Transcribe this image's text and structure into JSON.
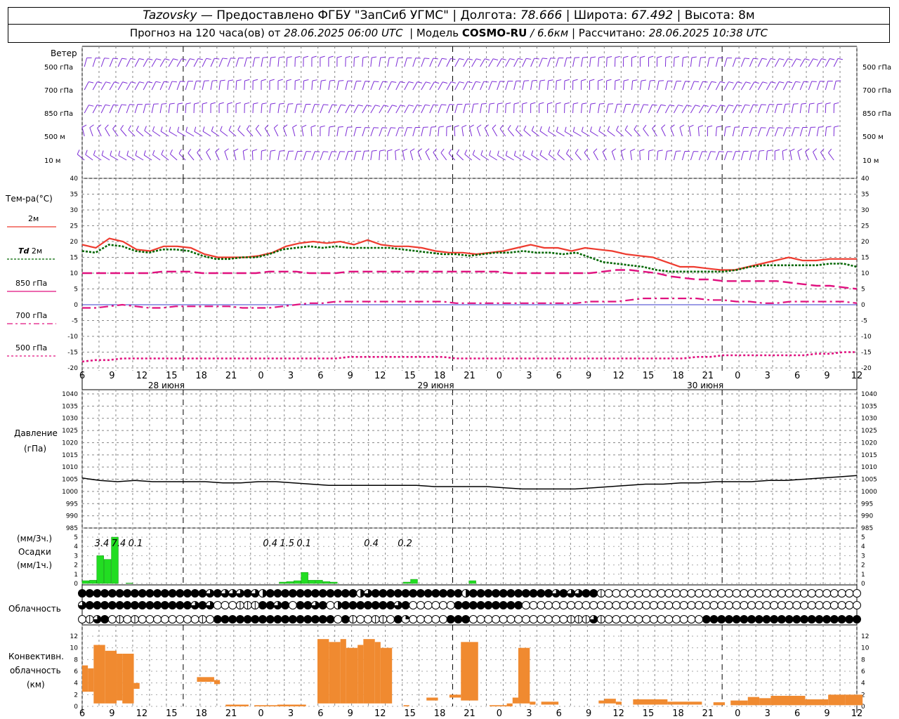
{
  "header": {
    "station": "Tazovsky",
    "provider": "Предоставлено ФГБУ \"ЗапСиб УГМС\"",
    "lon_label": "Долгота:",
    "lon": "78.666",
    "lat_label": "Широта:",
    "lat": "67.492",
    "alt_label": "Высота:",
    "alt": "8м",
    "forecast_prefix": "Прогноз на 120 часа(ов) от",
    "forecast_from": "28.06.2025 06:00 UTC",
    "model_label": "Модель",
    "model": "COSMO-RU",
    "resolution": "/ 6.6км",
    "calc_label": "Рассчитано:",
    "calc_time": "28.06.2025 10:38 UTC"
  },
  "labels": {
    "wind": "Ветер",
    "levels": [
      "500 гПа",
      "700 гПа",
      "850 гПа",
      "500 м",
      "10 м"
    ],
    "temp": "Тем-ра(°С)",
    "t2m": "2м",
    "td_prefix": "Td",
    "td_suffix": "2м",
    "t850": "850 гПа",
    "t700": "700 гПа",
    "t500": "500 гПа",
    "pressure": "Давление",
    "pressure_unit": "(гПа)",
    "precip_unit3": "(мм/3ч.)",
    "precip": "Осадки",
    "precip_unit1": "(мм/1ч.)",
    "cloud": "Облачность",
    "conv1": "Конвективн.",
    "conv2": "облачность",
    "conv3": "(км)"
  },
  "colors": {
    "t2m": "#ee3b2f",
    "td2m": "#006600",
    "t850": "#e0117f",
    "t700": "#e0117f",
    "t500": "#e0117f",
    "wind": "#7b2bd6",
    "pressure": "#000000",
    "precip": "#22dd22",
    "conv": "#f08a30"
  },
  "chart_data": {
    "type": "line",
    "x_ticks": [
      "6",
      "9",
      "12",
      "15",
      "18",
      "21",
      "0",
      "3",
      "6",
      "9",
      "12",
      "15",
      "18",
      "21",
      "0",
      "3",
      "6",
      "9",
      "12",
      "15",
      "18",
      "21",
      "0",
      "3",
      "6",
      "9",
      "12"
    ],
    "dates": [
      "28 июня",
      "29 июня",
      "30 июня"
    ],
    "temperature": {
      "ylim": [
        -20,
        40
      ],
      "ticks": [
        -20,
        -15,
        -10,
        -5,
        0,
        5,
        10,
        15,
        20,
        25,
        30,
        35,
        40
      ],
      "series": [
        {
          "name": "2м",
          "values": [
            19,
            18,
            21,
            20,
            17.5,
            17,
            18.5,
            18.5,
            18,
            16,
            15,
            15,
            15,
            15.5,
            16.5,
            18.5,
            19.5,
            20,
            19.5,
            20,
            19,
            20.5,
            19,
            18.5,
            18.5,
            18,
            17,
            16.5,
            16.5,
            16,
            16.5,
            17,
            18,
            19,
            18,
            18,
            17,
            18,
            17.5,
            17,
            16,
            15.5,
            15,
            13.5,
            12,
            12,
            11.5,
            11,
            11,
            12,
            13,
            14,
            15,
            14,
            14,
            14.5,
            14.5,
            14.5
          ]
        },
        {
          "name": "Td 2м",
          "values": [
            17,
            16.5,
            19,
            18.5,
            17,
            16.5,
            17.5,
            17.5,
            17,
            15.5,
            14.5,
            14.5,
            15,
            15,
            16,
            17.5,
            18,
            18.5,
            18,
            18.5,
            18,
            18,
            18,
            18,
            17.5,
            17,
            16.5,
            16,
            16,
            15.5,
            16,
            16.5,
            16.5,
            17,
            16.5,
            16.5,
            16,
            16.5,
            15,
            13.5,
            13,
            12.5,
            12,
            11,
            10.5,
            10.5,
            10.5,
            10.5,
            10.5,
            11,
            12,
            12.5,
            12.5,
            12.5,
            12.5,
            12.5,
            13,
            13,
            12
          ]
        },
        {
          "name": "850 гПа",
          "values": [
            10,
            10,
            10,
            10,
            10,
            10,
            10.5,
            10.5,
            10.5,
            10,
            10,
            10,
            10,
            10,
            10.5,
            10.5,
            10.5,
            10,
            10,
            10,
            10.5,
            10.5,
            10.5,
            10.5,
            10.5,
            10.5,
            10.5,
            10.5,
            10.5,
            10.5,
            10.5,
            10.5,
            10,
            10,
            10,
            10,
            10,
            10,
            10,
            10.5,
            11,
            11,
            10.5,
            10,
            9,
            8.5,
            8,
            8,
            7.5,
            7.5,
            7.5,
            7.5,
            7.5,
            7,
            6.5,
            6,
            6,
            5.5,
            5
          ]
        },
        {
          "name": "700 гПа",
          "values": [
            -1,
            -1,
            -0.5,
            0,
            -0.5,
            -1,
            -1,
            -0.5,
            -0.5,
            -0.5,
            -0.5,
            -0.5,
            -1,
            -1,
            -1,
            -0.5,
            0,
            0.5,
            0.5,
            1,
            1,
            1,
            1,
            1,
            1,
            1,
            1,
            1,
            0.5,
            0.5,
            0.5,
            0.5,
            0.5,
            0.5,
            0.5,
            0.5,
            0.5,
            0.5,
            1,
            1,
            1,
            1.5,
            2,
            2,
            2,
            2,
            2,
            1.5,
            1.5,
            1,
            1,
            0.5,
            0.5,
            1,
            1,
            1,
            1,
            1,
            0.5
          ]
        },
        {
          "name": "500 гПа",
          "values": [
            -18,
            -17.5,
            -17.5,
            -17,
            -17,
            -17,
            -17,
            -17,
            -17,
            -17,
            -17,
            -17,
            -17,
            -17,
            -17,
            -17,
            -17,
            -17,
            -17,
            -17,
            -16.5,
            -16.5,
            -16.5,
            -16.5,
            -16.5,
            -16.5,
            -16.5,
            -16.5,
            -17,
            -17,
            -17,
            -17,
            -17,
            -17,
            -17,
            -17,
            -17,
            -17,
            -17,
            -17,
            -17,
            -17,
            -17,
            -17,
            -17,
            -17,
            -16.5,
            -16.5,
            -16,
            -16,
            -16,
            -16,
            -16,
            -16,
            -16,
            -15.5,
            -15.5,
            -15,
            -15
          ]
        }
      ]
    },
    "pressure": {
      "ylim": [
        985,
        1040
      ],
      "ticks": [
        985,
        990,
        995,
        1000,
        1005,
        1010,
        1015,
        1020,
        1025,
        1030,
        1035,
        1040
      ],
      "series": [
        {
          "name": "Давление",
          "values": [
            1005.5,
            1004.5,
            1004,
            1004.5,
            1004,
            1004,
            1004,
            1004,
            1003.5,
            1003.5,
            1004,
            1004,
            1003.5,
            1003,
            1002.5,
            1002.5,
            1002.5,
            1002.5,
            1002.5,
            1002.5,
            1002,
            1002,
            1002,
            1002,
            1001.5,
            1001,
            1001,
            1001,
            1001,
            1001.5,
            1002,
            1002.5,
            1003,
            1003,
            1003.5,
            1003.5,
            1004,
            1004,
            1004,
            1004.5,
            1004.5,
            1005,
            1005.5,
            1006,
            1006.5
          ]
        }
      ]
    },
    "precipitation": {
      "ylim": [
        0,
        5
      ],
      "ticks": [
        0,
        1,
        2,
        3,
        4,
        5
      ],
      "totals_3h": [
        {
          "label": "3.4",
          "hour": 3
        },
        {
          "label": "7.4",
          "hour": 6
        },
        {
          "label": "0.1",
          "hour": 9
        },
        {
          "label": "0.4",
          "hour": 33
        },
        {
          "label": "1.5",
          "hour": 36
        },
        {
          "label": "0.1",
          "hour": 39
        },
        {
          "label": "0.4",
          "hour": 51
        },
        {
          "label": "0.2",
          "hour": 57
        }
      ],
      "hourly": [
        0.3,
        0.35,
        3,
        2.6,
        5,
        0,
        0.05,
        0,
        0,
        0,
        0,
        0,
        0,
        0,
        0,
        0,
        0,
        0,
        0,
        0,
        0,
        0,
        0,
        0,
        0,
        0,
        0,
        0.15,
        0.2,
        0.3,
        1.2,
        0.35,
        0.35,
        0.2,
        0.15,
        0,
        0,
        0,
        0,
        0,
        0,
        0,
        0,
        0,
        0.15,
        0.45,
        0,
        0,
        0,
        0,
        0,
        0,
        0,
        0.3,
        0,
        0,
        0,
        0,
        0,
        0,
        0,
        0,
        0,
        0,
        0,
        0,
        0,
        0,
        0,
        0,
        0,
        0,
        0,
        0,
        0,
        0,
        0,
        0,
        0,
        0,
        0,
        0,
        0,
        0,
        0,
        0,
        0,
        0,
        0,
        0,
        0,
        0,
        0,
        0,
        0,
        0,
        0,
        0,
        0,
        0,
        0,
        0,
        0,
        0,
        0,
        0,
        0,
        0,
        0,
        0,
        0,
        0,
        0,
        0,
        0,
        0,
        0,
        0,
        0,
        0,
        0,
        0,
        0,
        0,
        0,
        0,
        0,
        0,
        0,
        0,
        0,
        0,
        0,
        0,
        0,
        0,
        0,
        0,
        0,
        0,
        0,
        0,
        0,
        0,
        0,
        0,
        0,
        0,
        0,
        0,
        0,
        0,
        0,
        0,
        0,
        0,
        0,
        0,
        0,
        0,
        0,
        0,
        0,
        0,
        0,
        0,
        0,
        0,
        0,
        0,
        0,
        0,
        0,
        0,
        0,
        0,
        0,
        0,
        0,
        0,
        0,
        0,
        0,
        0,
        0,
        0,
        0,
        0,
        0,
        0,
        0,
        0,
        0,
        0,
        0,
        0,
        0,
        0,
        0,
        0
      ]
    },
    "cloudiness": {
      "rows": [
        "88888888888888888585558538888888888883588888888888838888888888858558810000000000000000000000000000000000",
        "58888888888888858500011188586885863888888858000000888888888000000000000000000000000000000000000000000000",
        "01580101000000001088888888888888880810011084000008880000000000000111510000000000000888888888888888888888"
      ]
    },
    "convective": {
      "ylim": [
        0,
        12
      ],
      "ticks": [
        0,
        2,
        4,
        6,
        8,
        10,
        12
      ],
      "bars": [
        {
          "start": 0,
          "end": 1,
          "base": 2.5,
          "top": 7
        },
        {
          "start": 1,
          "end": 2,
          "base": 2.5,
          "top": 6.5
        },
        {
          "start": 2,
          "end": 4,
          "base": 0.5,
          "top": 10.5
        },
        {
          "start": 4,
          "end": 6,
          "base": 0.5,
          "top": 9.5
        },
        {
          "start": 6,
          "end": 7,
          "base": 1,
          "top": 9
        },
        {
          "start": 7,
          "end": 9,
          "base": 0.5,
          "top": 9
        },
        {
          "start": 9,
          "end": 10,
          "base": 3,
          "top": 4
        },
        {
          "start": 20,
          "end": 23,
          "base": 4.2,
          "top": 5
        },
        {
          "start": 23,
          "end": 24,
          "base": 3.8,
          "top": 4.5
        },
        {
          "start": 25,
          "end": 29,
          "base": 0,
          "top": 0.3
        },
        {
          "start": 30,
          "end": 34,
          "base": 0,
          "top": 0.2
        },
        {
          "start": 34,
          "end": 39,
          "base": 0,
          "top": 0.3
        },
        {
          "start": 41,
          "end": 43,
          "base": 0.5,
          "top": 11.5
        },
        {
          "start": 43,
          "end": 45,
          "base": 0.5,
          "top": 11
        },
        {
          "start": 45,
          "end": 46,
          "base": 0.5,
          "top": 11.5
        },
        {
          "start": 46,
          "end": 48,
          "base": 0.5,
          "top": 10
        },
        {
          "start": 48,
          "end": 49,
          "base": 0.5,
          "top": 10.5
        },
        {
          "start": 49,
          "end": 51,
          "base": 0.5,
          "top": 11.5
        },
        {
          "start": 51,
          "end": 52,
          "base": 0.5,
          "top": 11
        },
        {
          "start": 52,
          "end": 54,
          "base": 0.5,
          "top": 10
        },
        {
          "start": 56,
          "end": 57,
          "base": 0,
          "top": 0.2
        },
        {
          "start": 60,
          "end": 62,
          "base": 1,
          "top": 1.5
        },
        {
          "start": 64,
          "end": 66,
          "base": 1.5,
          "top": 2
        },
        {
          "start": 66,
          "end": 69,
          "base": 1,
          "top": 11
        },
        {
          "start": 71,
          "end": 74,
          "base": 0,
          "top": 0.2
        },
        {
          "start": 74,
          "end": 75,
          "base": 0,
          "top": 0.5
        },
        {
          "start": 75,
          "end": 76,
          "base": 0.5,
          "top": 1.5
        },
        {
          "start": 76,
          "end": 78,
          "base": 0.5,
          "top": 10
        },
        {
          "start": 78,
          "end": 79,
          "base": 0.3,
          "top": 0.8
        },
        {
          "start": 80,
          "end": 83,
          "base": 0.3,
          "top": 0.8
        },
        {
          "start": 90,
          "end": 91,
          "base": 0.5,
          "top": 1
        },
        {
          "start": 91,
          "end": 93,
          "base": 0.5,
          "top": 1.3
        },
        {
          "start": 93,
          "end": 94,
          "base": 0.3,
          "top": 0.8
        },
        {
          "start": 96,
          "end": 102,
          "base": 0.3,
          "top": 1.2
        },
        {
          "start": 102,
          "end": 108,
          "base": 0.3,
          "top": 0.8
        },
        {
          "start": 110,
          "end": 112,
          "base": 0.2,
          "top": 0.7
        },
        {
          "start": 113,
          "end": 116,
          "base": 0.2,
          "top": 1
        },
        {
          "start": 116,
          "end": 118,
          "base": 0.2,
          "top": 1.6
        },
        {
          "start": 118,
          "end": 120,
          "base": 0.2,
          "top": 1.4
        },
        {
          "start": 120,
          "end": 126,
          "base": 0.2,
          "top": 1.8
        },
        {
          "start": 126,
          "end": 130,
          "base": 0.2,
          "top": 1.2
        },
        {
          "start": 130,
          "end": 133,
          "base": 0.2,
          "top": 2
        },
        {
          "start": 133,
          "end": 136,
          "base": 0.2,
          "top": 2
        }
      ]
    }
  }
}
